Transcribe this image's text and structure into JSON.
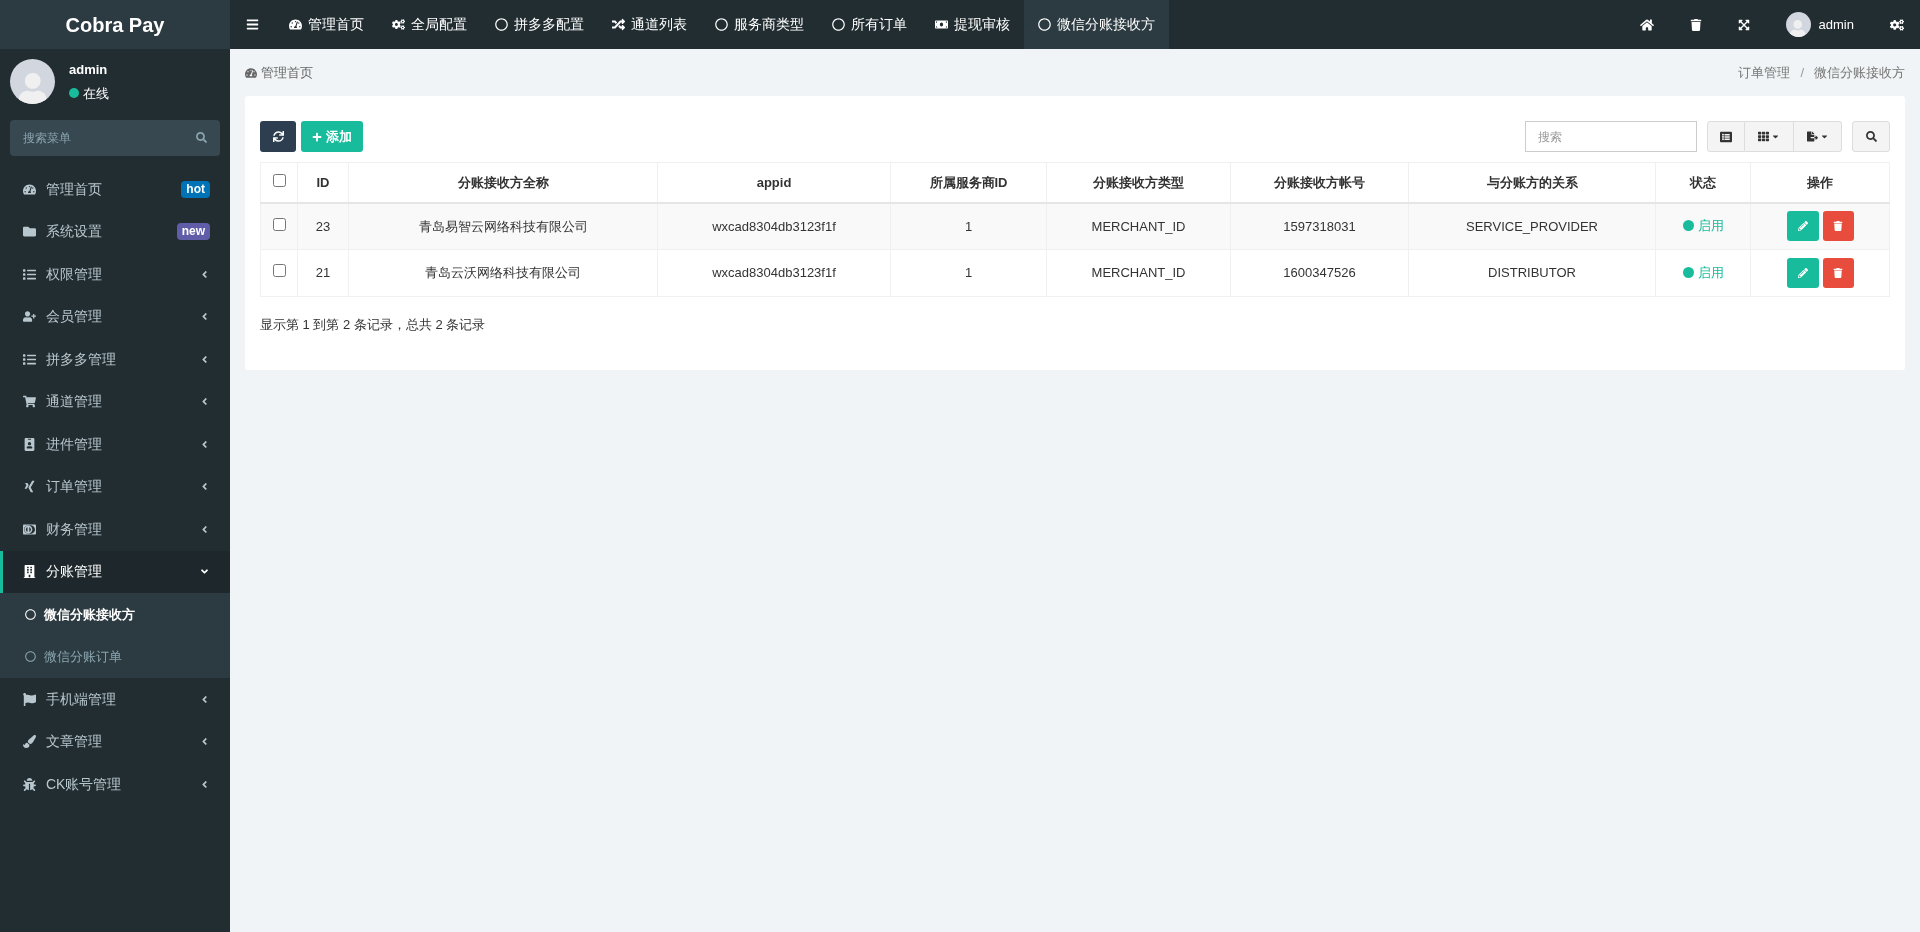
{
  "brand": "Cobra Pay",
  "top_tabs": [
    {
      "label": "管理首页",
      "selected": false
    },
    {
      "label": "全局配置",
      "selected": false
    },
    {
      "label": "拼多多配置",
      "selected": false
    },
    {
      "label": "通道列表",
      "selected": false
    },
    {
      "label": "服务商类型",
      "selected": false
    },
    {
      "label": "所有订单",
      "selected": false
    },
    {
      "label": "提现审核",
      "selected": false
    },
    {
      "label": "微信分账接收方",
      "selected": true
    }
  ],
  "top_user": "admin",
  "user": {
    "name": "admin",
    "status": "在线",
    "online": true
  },
  "menu_search": {
    "placeholder": "搜索菜单"
  },
  "menu": [
    {
      "label": "管理首页",
      "badge": {
        "text": "hot",
        "color": "#0073b7"
      },
      "selected": false
    },
    {
      "label": "系统设置",
      "badge": {
        "text": "new",
        "color": "#605ca8"
      },
      "selected": false
    },
    {
      "label": "权限管理",
      "expanded": false,
      "selected": false
    },
    {
      "label": "会员管理",
      "expanded": false,
      "selected": false
    },
    {
      "label": "拼多多管理",
      "expanded": false,
      "selected": false
    },
    {
      "label": "通道管理",
      "expanded": false,
      "selected": false
    },
    {
      "label": "进件管理",
      "expanded": false,
      "selected": false
    },
    {
      "label": "订单管理",
      "expanded": false,
      "selected": false
    },
    {
      "label": "财务管理",
      "expanded": false,
      "selected": false
    },
    {
      "label": "分账管理",
      "expanded": true,
      "selected": true,
      "children": [
        {
          "label": "微信分账接收方",
          "selected": true
        },
        {
          "label": "微信分账订单",
          "selected": false
        }
      ]
    },
    {
      "label": "手机端管理",
      "expanded": false,
      "selected": false
    },
    {
      "label": "文章管理",
      "expanded": false,
      "selected": false
    },
    {
      "label": "CK账号管理",
      "expanded": false,
      "selected": false
    }
  ],
  "breadcrumb_home": "管理首页",
  "breadcrumb": [
    "订单管理",
    "微信分账接收方"
  ],
  "breadcrumb_separator": "/",
  "toolbar": {
    "add": "添加",
    "search": {
      "placeholder": "搜索"
    }
  },
  "table": {
    "select_all": {
      "checked": false
    },
    "columns": [
      "ID",
      "分账接收方全称",
      "appid",
      "所属服务商ID",
      "分账接收方类型",
      "分账接收方帐号",
      "与分账方的关系",
      "状态",
      "操作"
    ],
    "rows": [
      {
        "checked": false,
        "cells": [
          "23",
          "青岛易智云网络科技有限公司",
          "wxcad8304db3123f1f",
          "1",
          "MERCHANT_ID",
          "1597318031",
          "SERVICE_PROVIDER"
        ],
        "status": "启用",
        "color": "#18bc9c"
      },
      {
        "checked": false,
        "cells": [
          "21",
          "青岛云沃网络科技有限公司",
          "wxcad8304db3123f1f",
          "1",
          "MERCHANT_ID",
          "1600347526",
          "DISTRIBUTOR"
        ],
        "status": "启用",
        "color": "#18bc9c"
      }
    ]
  },
  "pagination_info": "显示第 1 到第 2 条记录，总共 2 条记录"
}
